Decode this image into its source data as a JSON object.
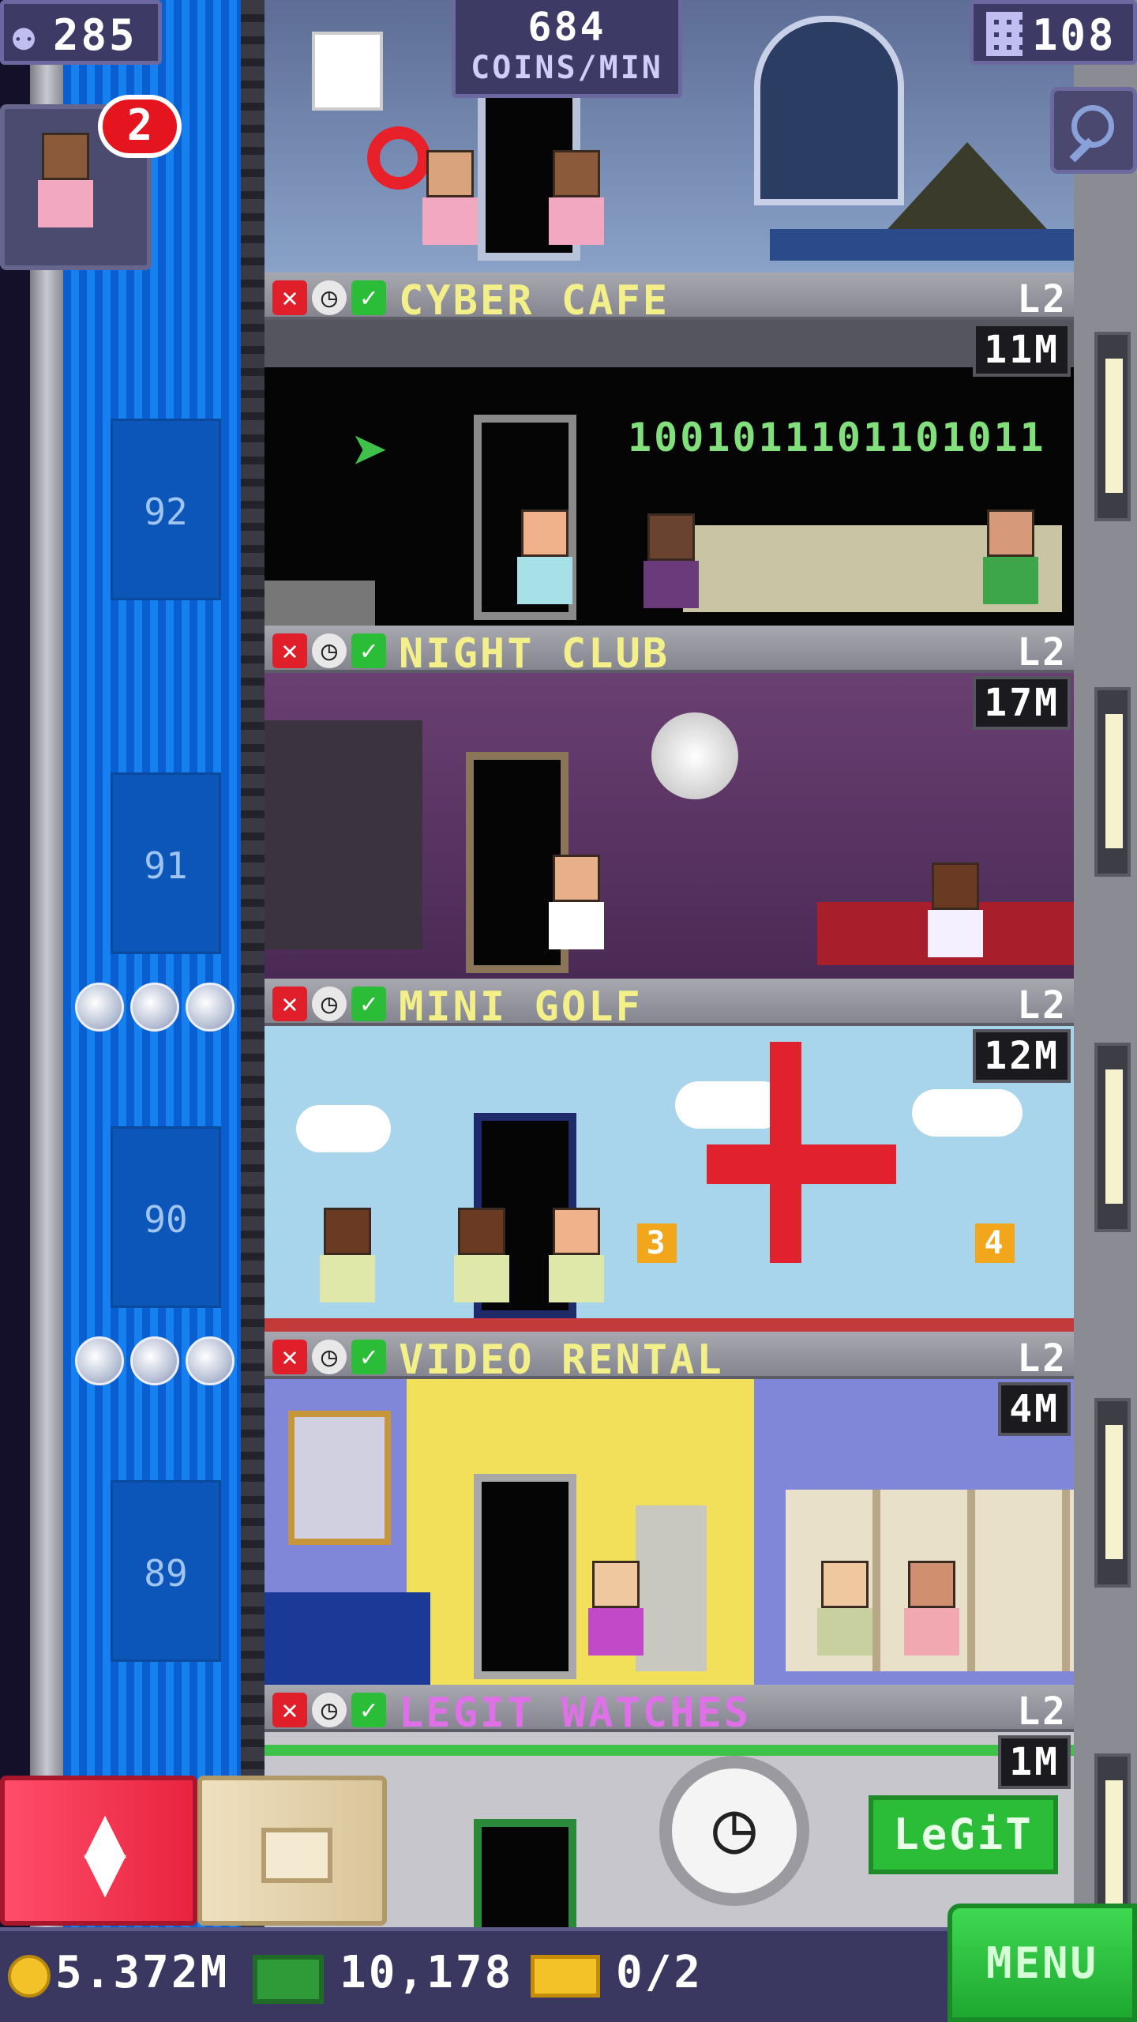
{
  "hud": {
    "population": "285",
    "coins_per_min_value": "684",
    "coins_per_min_unit": "COINS/MIN",
    "floors": "108",
    "visitor_badge": "2"
  },
  "shaft": {
    "floor_numbers": [
      "92",
      "91",
      "90",
      "89"
    ]
  },
  "floors": [
    {
      "name": "CYBER CAFE",
      "level": "L2",
      "value": "11M",
      "binary": "1001011101101011"
    },
    {
      "name": "NIGHT CLUB",
      "level": "L2",
      "value": "17M"
    },
    {
      "name": "MINI GOLF",
      "level": "L2",
      "value": "12M",
      "hole_a": "3",
      "hole_b": "4"
    },
    {
      "name": "VIDEO RENTAL",
      "level": "L2",
      "value": "4M"
    },
    {
      "name": "LEGIT WATCHES",
      "level": "L2",
      "value": "1M",
      "sign": "LeGiT"
    }
  ],
  "bottom": {
    "coins": "5.372M",
    "bux": "10,178",
    "tickets": "0/2",
    "menu_label": "MENU"
  },
  "colors": {
    "shaft_blue": "#1680f0",
    "floor_title_yellow": "#f3f08a",
    "legit_title_pink": "#e070e8",
    "menu_green": "#2bc23e",
    "badge_red": "#e4151f"
  },
  "icons": [
    "population-icon",
    "floors-icon",
    "search-icon",
    "cancel-icon",
    "clock-icon",
    "check-icon",
    "star-icon",
    "elevator-icon",
    "storage-box-icon",
    "coin-icon",
    "bux-icon",
    "ticket-icon"
  ]
}
